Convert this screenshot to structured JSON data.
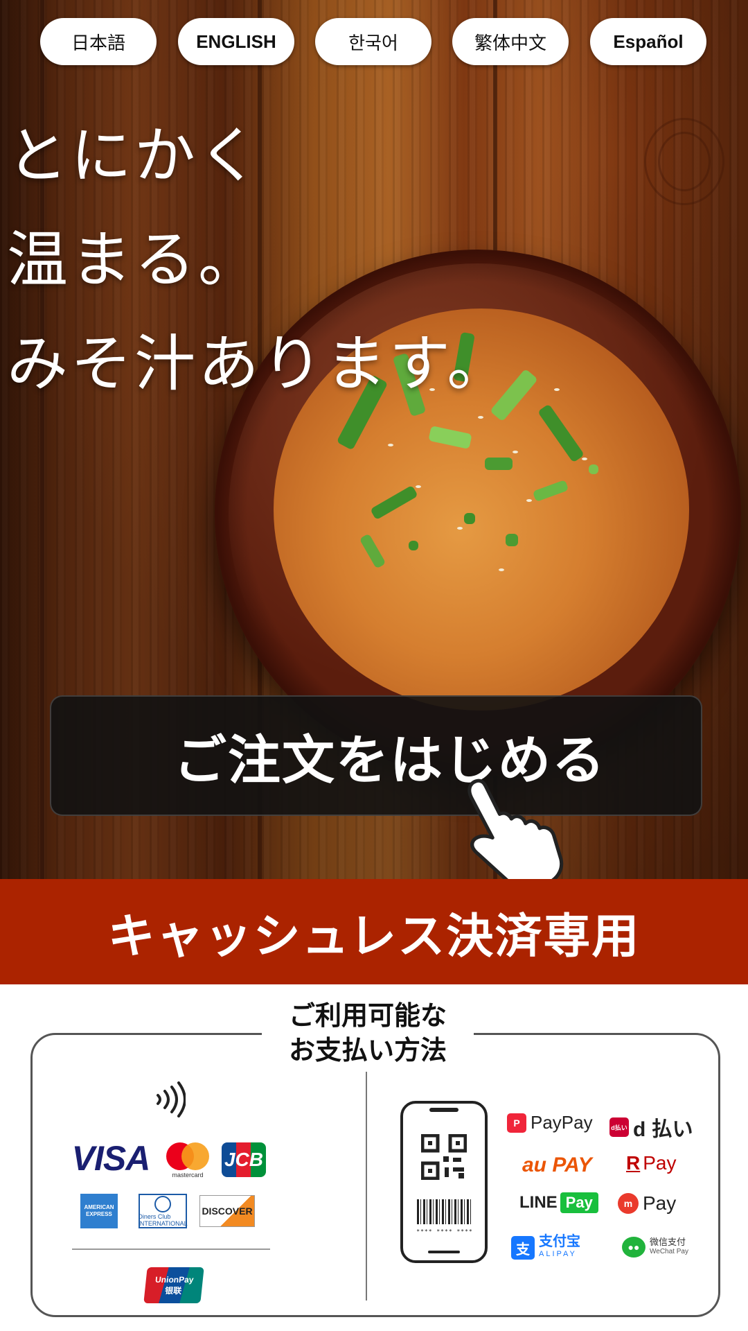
{
  "languages": [
    {
      "label": "日本語",
      "bold": false
    },
    {
      "label": "ENGLISH",
      "bold": true
    },
    {
      "label": "한국어",
      "bold": false
    },
    {
      "label": "繁体中文",
      "bold": false
    },
    {
      "label": "Español",
      "bold": true
    }
  ],
  "hero": {
    "lines": [
      "とにかく",
      "温まる。",
      "みそ汁あります。"
    ]
  },
  "cta": {
    "label": "ご注文をはじめる"
  },
  "banner": {
    "text": "キャッシュレス決済専用"
  },
  "payments": {
    "title_lines": [
      "ご利用可能な",
      "お支払い方法"
    ],
    "cards": {
      "visa": "VISA",
      "mastercard": "mastercard",
      "jcb": "JCB",
      "amex": "AMERICAN EXPRESS",
      "diners": "Diners Club INTERNATIONAL",
      "discover": "DISCOVER",
      "unionpay": "UnionPay",
      "unionpay_cn": "银联"
    },
    "qr_note": "**** **** ****",
    "qr_services": {
      "paypay": "PayPay",
      "dbarai_badge": "d払い",
      "dbarai": "d 払い",
      "aupay": "au PAY",
      "rpay_r": "R",
      "rpay": "Pay",
      "line": "LINE",
      "line_pay": "Pay",
      "merpay": "Pay",
      "alipay_cn": "支付宝",
      "alipay_en": "ALIPAY",
      "wechat_cn": "微信支付",
      "wechat_en": "WeChat Pay"
    }
  },
  "colors": {
    "banner": "#ab2300",
    "cta_bg": "#121212"
  }
}
